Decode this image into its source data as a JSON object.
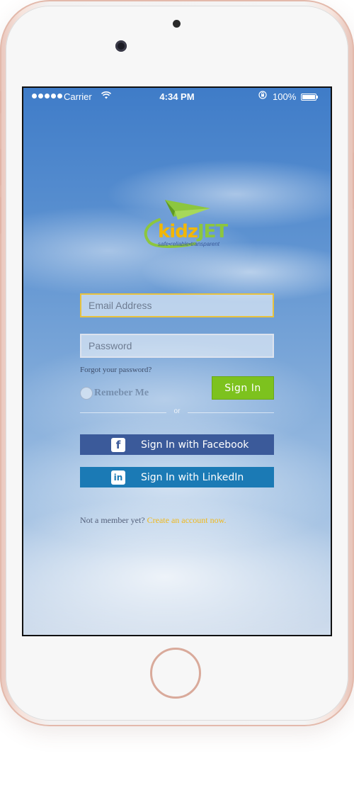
{
  "status_bar": {
    "carrier": "Carrier",
    "time": "4:34 PM",
    "battery": "100%"
  },
  "logo": {
    "kidz": "kidz",
    "jet": "JET",
    "tagline": "safe•reliable•transparent",
    "colors": {
      "kidz": "#f2b705",
      "jet": "#8cc63f"
    }
  },
  "form": {
    "email_placeholder": "Email Address",
    "password_placeholder": "Password",
    "forgot": "Forgot your password?",
    "remember": "Remeber Me",
    "signin": "Sign In",
    "or": "or"
  },
  "social": {
    "facebook": "Sign In with Facebook",
    "linkedin": "Sign In with LinkedIn"
  },
  "footer": {
    "prompt": "Not a member yet?",
    "link": "Create an account now."
  },
  "colors": {
    "signin": "#7dc21e",
    "facebook": "#3b5a9a",
    "linkedin": "#1b7ab5",
    "link": "#f0b819"
  }
}
